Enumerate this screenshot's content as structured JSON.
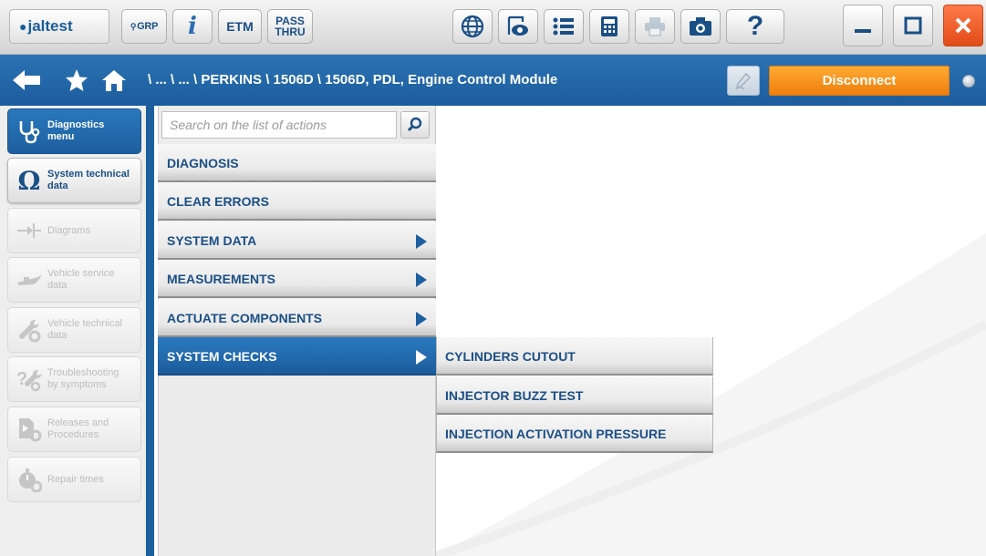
{
  "app": {
    "logo_text": "jaltest"
  },
  "toolbar": {
    "grp_label": "GRP",
    "info_label": "i",
    "etm_label": "ETM",
    "pass_thru_line1": "PASS",
    "pass_thru_line2": "THRU",
    "help_label": "?",
    "icons": [
      "globe-icon",
      "eye-icon",
      "list-icon",
      "calculator-icon",
      "print-icon",
      "camera-icon",
      "help-icon",
      "minimize-icon",
      "maximize-icon",
      "close-icon"
    ]
  },
  "nav": {
    "breadcrumb": "\\ ... \\ ... \\ PERKINS \\ 1506D \\ 1506D, PDL, Engine Control Module",
    "disconnect_label": "Disconnect"
  },
  "sidebar": {
    "items": [
      {
        "label_line1": "Diagnostics",
        "label_line2": "menu",
        "icon": "stethoscope-icon",
        "state": "active"
      },
      {
        "label_line1": "System technical",
        "label_line2": "data",
        "icon": "omega-icon",
        "state": "enabled"
      },
      {
        "label_line1": "Diagrams",
        "label_line2": "",
        "icon": "diagram-icon",
        "state": "disabled"
      },
      {
        "label_line1": "Vehicle service",
        "label_line2": "data",
        "icon": "oil-can-icon",
        "state": "disabled"
      },
      {
        "label_line1": "Vehicle technical",
        "label_line2": "data",
        "icon": "wrench-gear-icon",
        "state": "disabled"
      },
      {
        "label_line1": "Troubleshooting",
        "label_line2": "by symptoms",
        "icon": "question-wrench-icon",
        "state": "disabled"
      },
      {
        "label_line1": "Releases and",
        "label_line2": "Procedures",
        "icon": "document-gear-icon",
        "state": "disabled"
      },
      {
        "label_line1": "Repair times",
        "label_line2": "",
        "icon": "stopwatch-icon",
        "state": "disabled"
      }
    ]
  },
  "actions": {
    "search_placeholder": "Search on the list of actions",
    "items": [
      {
        "label": "DIAGNOSIS",
        "has_submenu": false
      },
      {
        "label": "CLEAR ERRORS",
        "has_submenu": false
      },
      {
        "label": "SYSTEM DATA",
        "has_submenu": true
      },
      {
        "label": "MEASUREMENTS",
        "has_submenu": true
      },
      {
        "label": "ACTUATE COMPONENTS",
        "has_submenu": true
      },
      {
        "label": "SYSTEM CHECKS",
        "has_submenu": true,
        "selected": true
      }
    ]
  },
  "submenu": {
    "items": [
      {
        "label": "CYLINDERS CUTOUT"
      },
      {
        "label": "INJECTOR BUZZ TEST"
      },
      {
        "label": "INJECTION ACTIVATION PRESSURE"
      }
    ]
  },
  "colors": {
    "brand_blue": "#1e5fa0",
    "disconnect_orange": "#f5901c",
    "close_red": "#e14b18"
  }
}
